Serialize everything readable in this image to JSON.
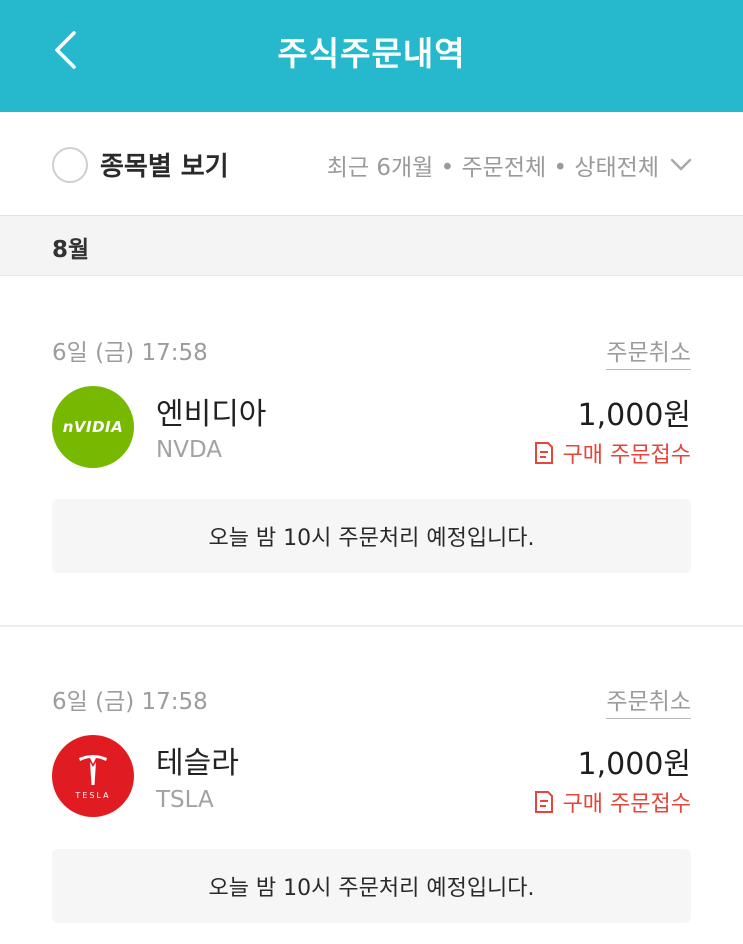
{
  "header": {
    "title": "주식주문내역",
    "back_icon": "chevron-left-icon",
    "color": "#26b8cd"
  },
  "filter": {
    "toggle_label": "종목별 보기",
    "summary": "최근 6개월 • 주문전체 • 상태전체",
    "dropdown_icon": "chevron-down-icon"
  },
  "month": {
    "label": "8월"
  },
  "orders": [
    {
      "date": "6일 (금) 17:58",
      "cancel_label": "주문취소",
      "name": "엔비디아",
      "ticker": "NVDA",
      "logo_text": "nVIDIA",
      "logo_color": "#76b900",
      "amount": "1,000원",
      "status": "구매 주문접수",
      "status_color": "#e5463a",
      "notice": "오늘 밤 10시 주문처리 예정입니다."
    },
    {
      "date": "6일 (금) 17:58",
      "cancel_label": "주문취소",
      "name": "테슬라",
      "ticker": "TSLA",
      "logo_text": "TESLA",
      "logo_color": "#e01b22",
      "amount": "1,000원",
      "status": "구매 주문접수",
      "status_color": "#e5463a",
      "notice": "오늘 밤 10시 주문처리 예정입니다."
    }
  ]
}
